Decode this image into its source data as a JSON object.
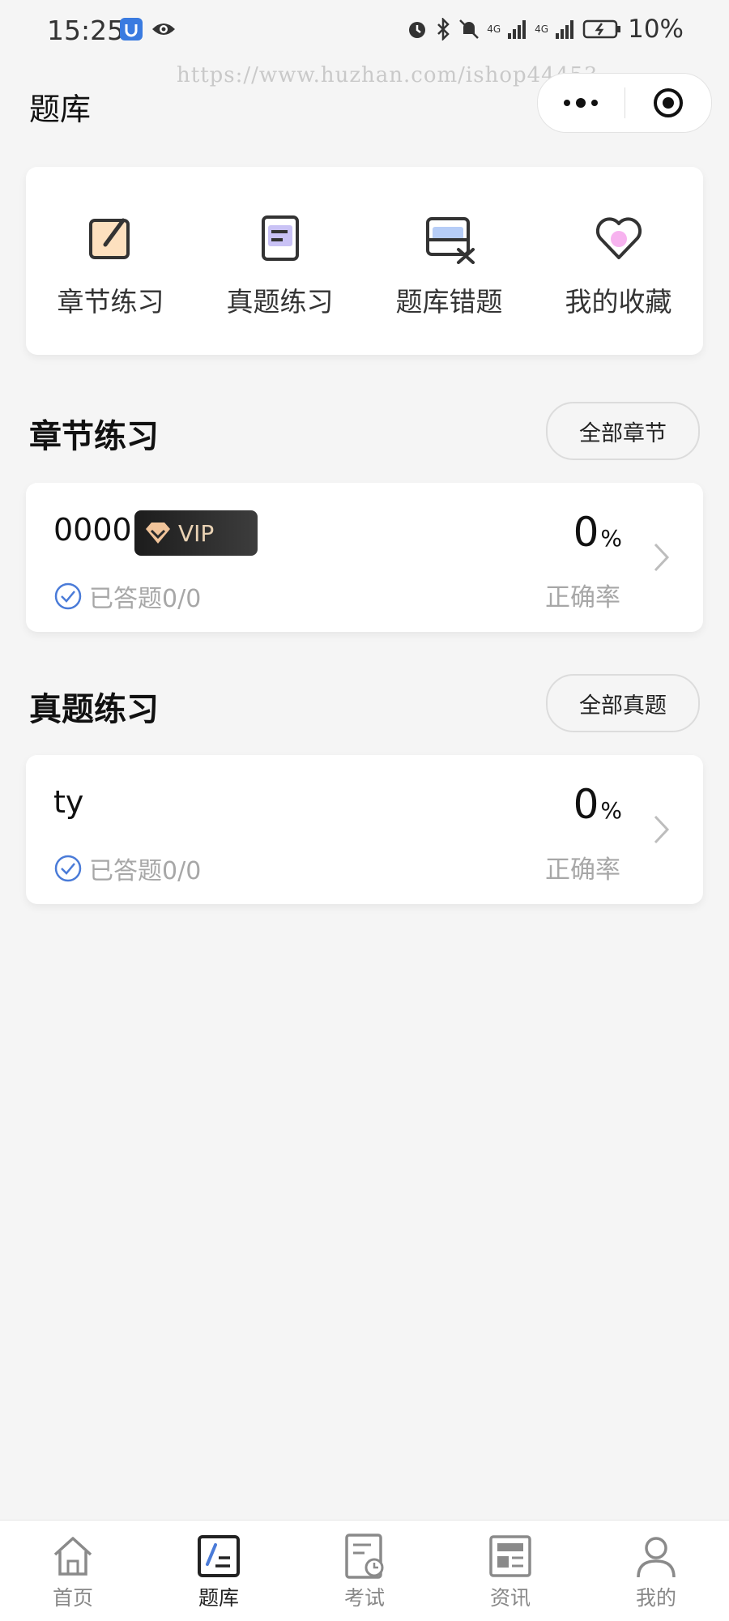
{
  "status_bar": {
    "time": "15:25",
    "battery": "10%",
    "network_label": "4G"
  },
  "watermark": "https://www.huzhan.com/ishop44453",
  "nav": {
    "title": "题库"
  },
  "quick_actions": [
    {
      "label": "章节练习",
      "icon": "edit-square-icon"
    },
    {
      "label": "真题练习",
      "icon": "document-icon"
    },
    {
      "label": "题库错题",
      "icon": "tray-x-icon"
    },
    {
      "label": "我的收藏",
      "icon": "heart-icon"
    }
  ],
  "chapter_section": {
    "title": "章节练习",
    "all_button": "全部章节",
    "item": {
      "name": "0000",
      "badge": "VIP",
      "answered": "已答题0/0",
      "rate": "0",
      "rate_unit": "%",
      "rate_label": "正确率"
    }
  },
  "exam_section": {
    "title": "真题练习",
    "all_button": "全部真题",
    "item": {
      "name": "ty",
      "answered": "已答题0/0",
      "rate": "0",
      "rate_unit": "%",
      "rate_label": "正确率"
    }
  },
  "tab_bar": [
    {
      "label": "首页",
      "icon": "home-icon",
      "active": false
    },
    {
      "label": "题库",
      "icon": "question-bank-icon",
      "active": true
    },
    {
      "label": "考试",
      "icon": "exam-icon",
      "active": false
    },
    {
      "label": "资讯",
      "icon": "news-icon",
      "active": false
    },
    {
      "label": "我的",
      "icon": "profile-icon",
      "active": false
    }
  ],
  "colors": {
    "accent_blue": "#4a7bd8",
    "vip_gold": "#e9d2b4",
    "muted_text": "#a7a7a7",
    "background": "#f5f5f5"
  }
}
